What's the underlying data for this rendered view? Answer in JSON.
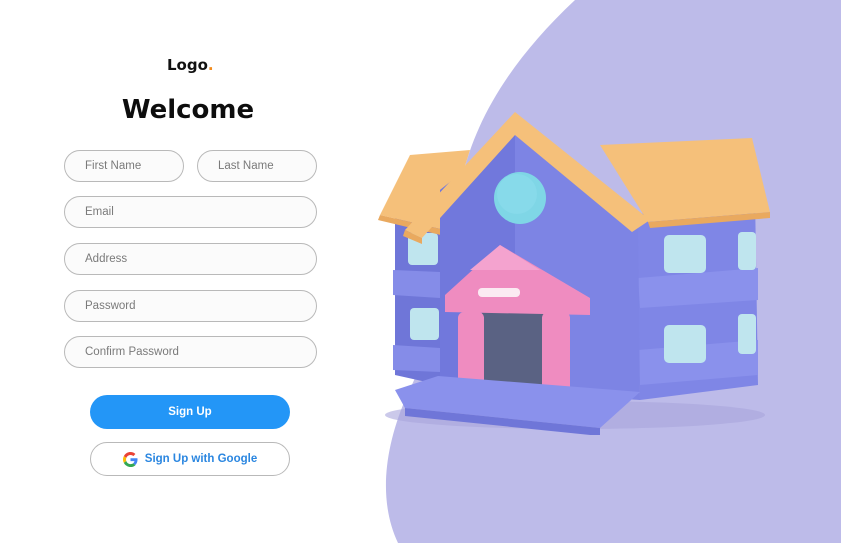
{
  "brand": {
    "logo_text": "Logo",
    "logo_dot": ".",
    "dot_color": "#f28c1e"
  },
  "form": {
    "title": "Welcome",
    "first_name": {
      "placeholder": "First Name",
      "value": ""
    },
    "last_name": {
      "placeholder": "Last Name",
      "value": ""
    },
    "email": {
      "placeholder": "Email",
      "value": ""
    },
    "address": {
      "placeholder": "Address",
      "value": ""
    },
    "password": {
      "placeholder": "Password",
      "value": ""
    },
    "confirm_password": {
      "placeholder": "Confirm Password",
      "value": ""
    },
    "signup_label": "Sign Up",
    "google_label": "Sign Up with Google"
  },
  "theme": {
    "primary": "#2396f7",
    "accent_background": "#bdbbe9",
    "house_body": "#7f86e6",
    "house_roof": "#f5c07a",
    "house_porch": "#ef8cc0",
    "house_window": "#bfe5ee",
    "house_round_window": "#7fd6e6"
  },
  "illustration": {
    "icon": "house-illustration"
  },
  "icons": {
    "google": "google-g-icon"
  }
}
